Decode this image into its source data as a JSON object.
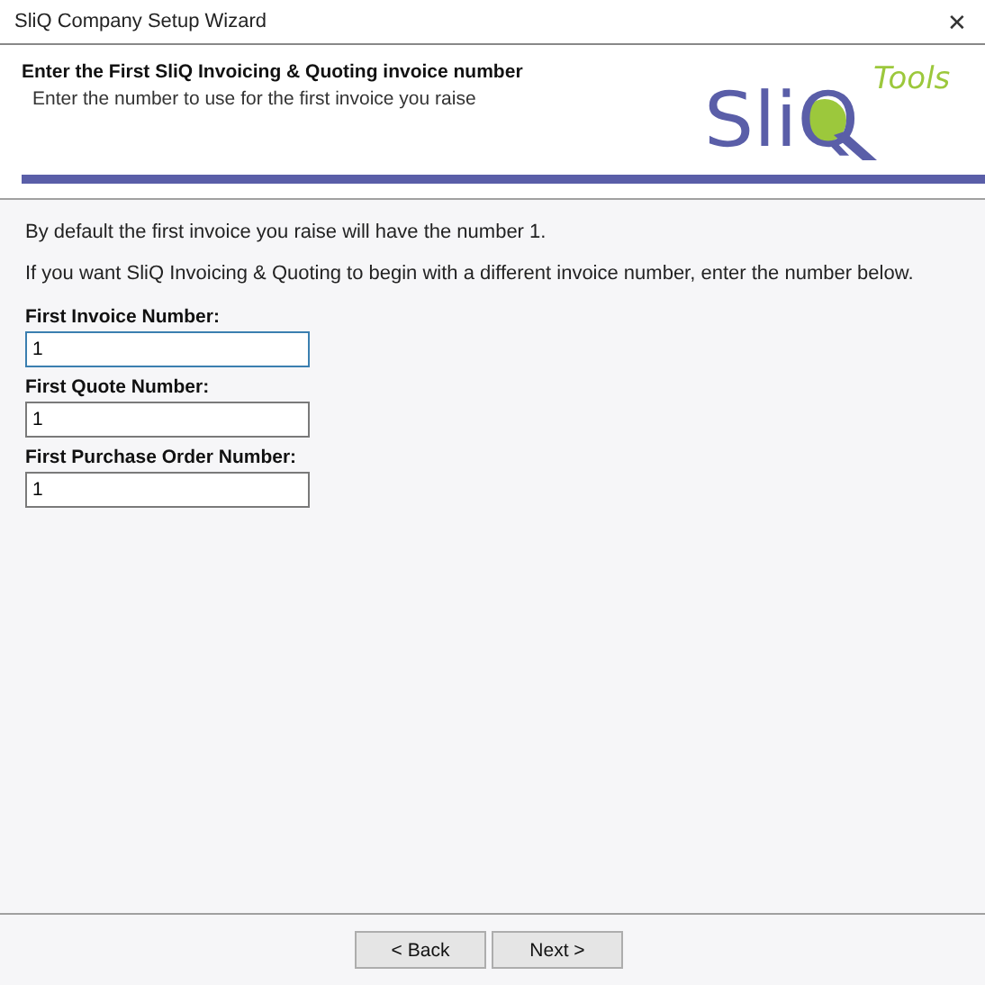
{
  "window": {
    "title": "SliQ Company Setup Wizard",
    "close": "✕"
  },
  "header": {
    "title": "Enter the First SliQ Invoicing & Quoting invoice number",
    "subtitle": "Enter the number to use for the first invoice you raise",
    "logo": {
      "brand": "SliQ",
      "tag": "Tools"
    }
  },
  "body": {
    "paragraphs": [
      "By default the first invoice you raise will have the number 1.",
      "If you want SliQ Invoicing & Quoting to begin with a different invoice number, enter the number below."
    ],
    "fields": [
      {
        "label": "First Invoice Number:",
        "value": "1",
        "focused": true
      },
      {
        "label": "First Quote Number:",
        "value": "1",
        "focused": false
      },
      {
        "label": "First Purchase Order Number:",
        "value": "1",
        "focused": false
      }
    ]
  },
  "buttons": [
    "< Back",
    "Next >"
  ]
}
